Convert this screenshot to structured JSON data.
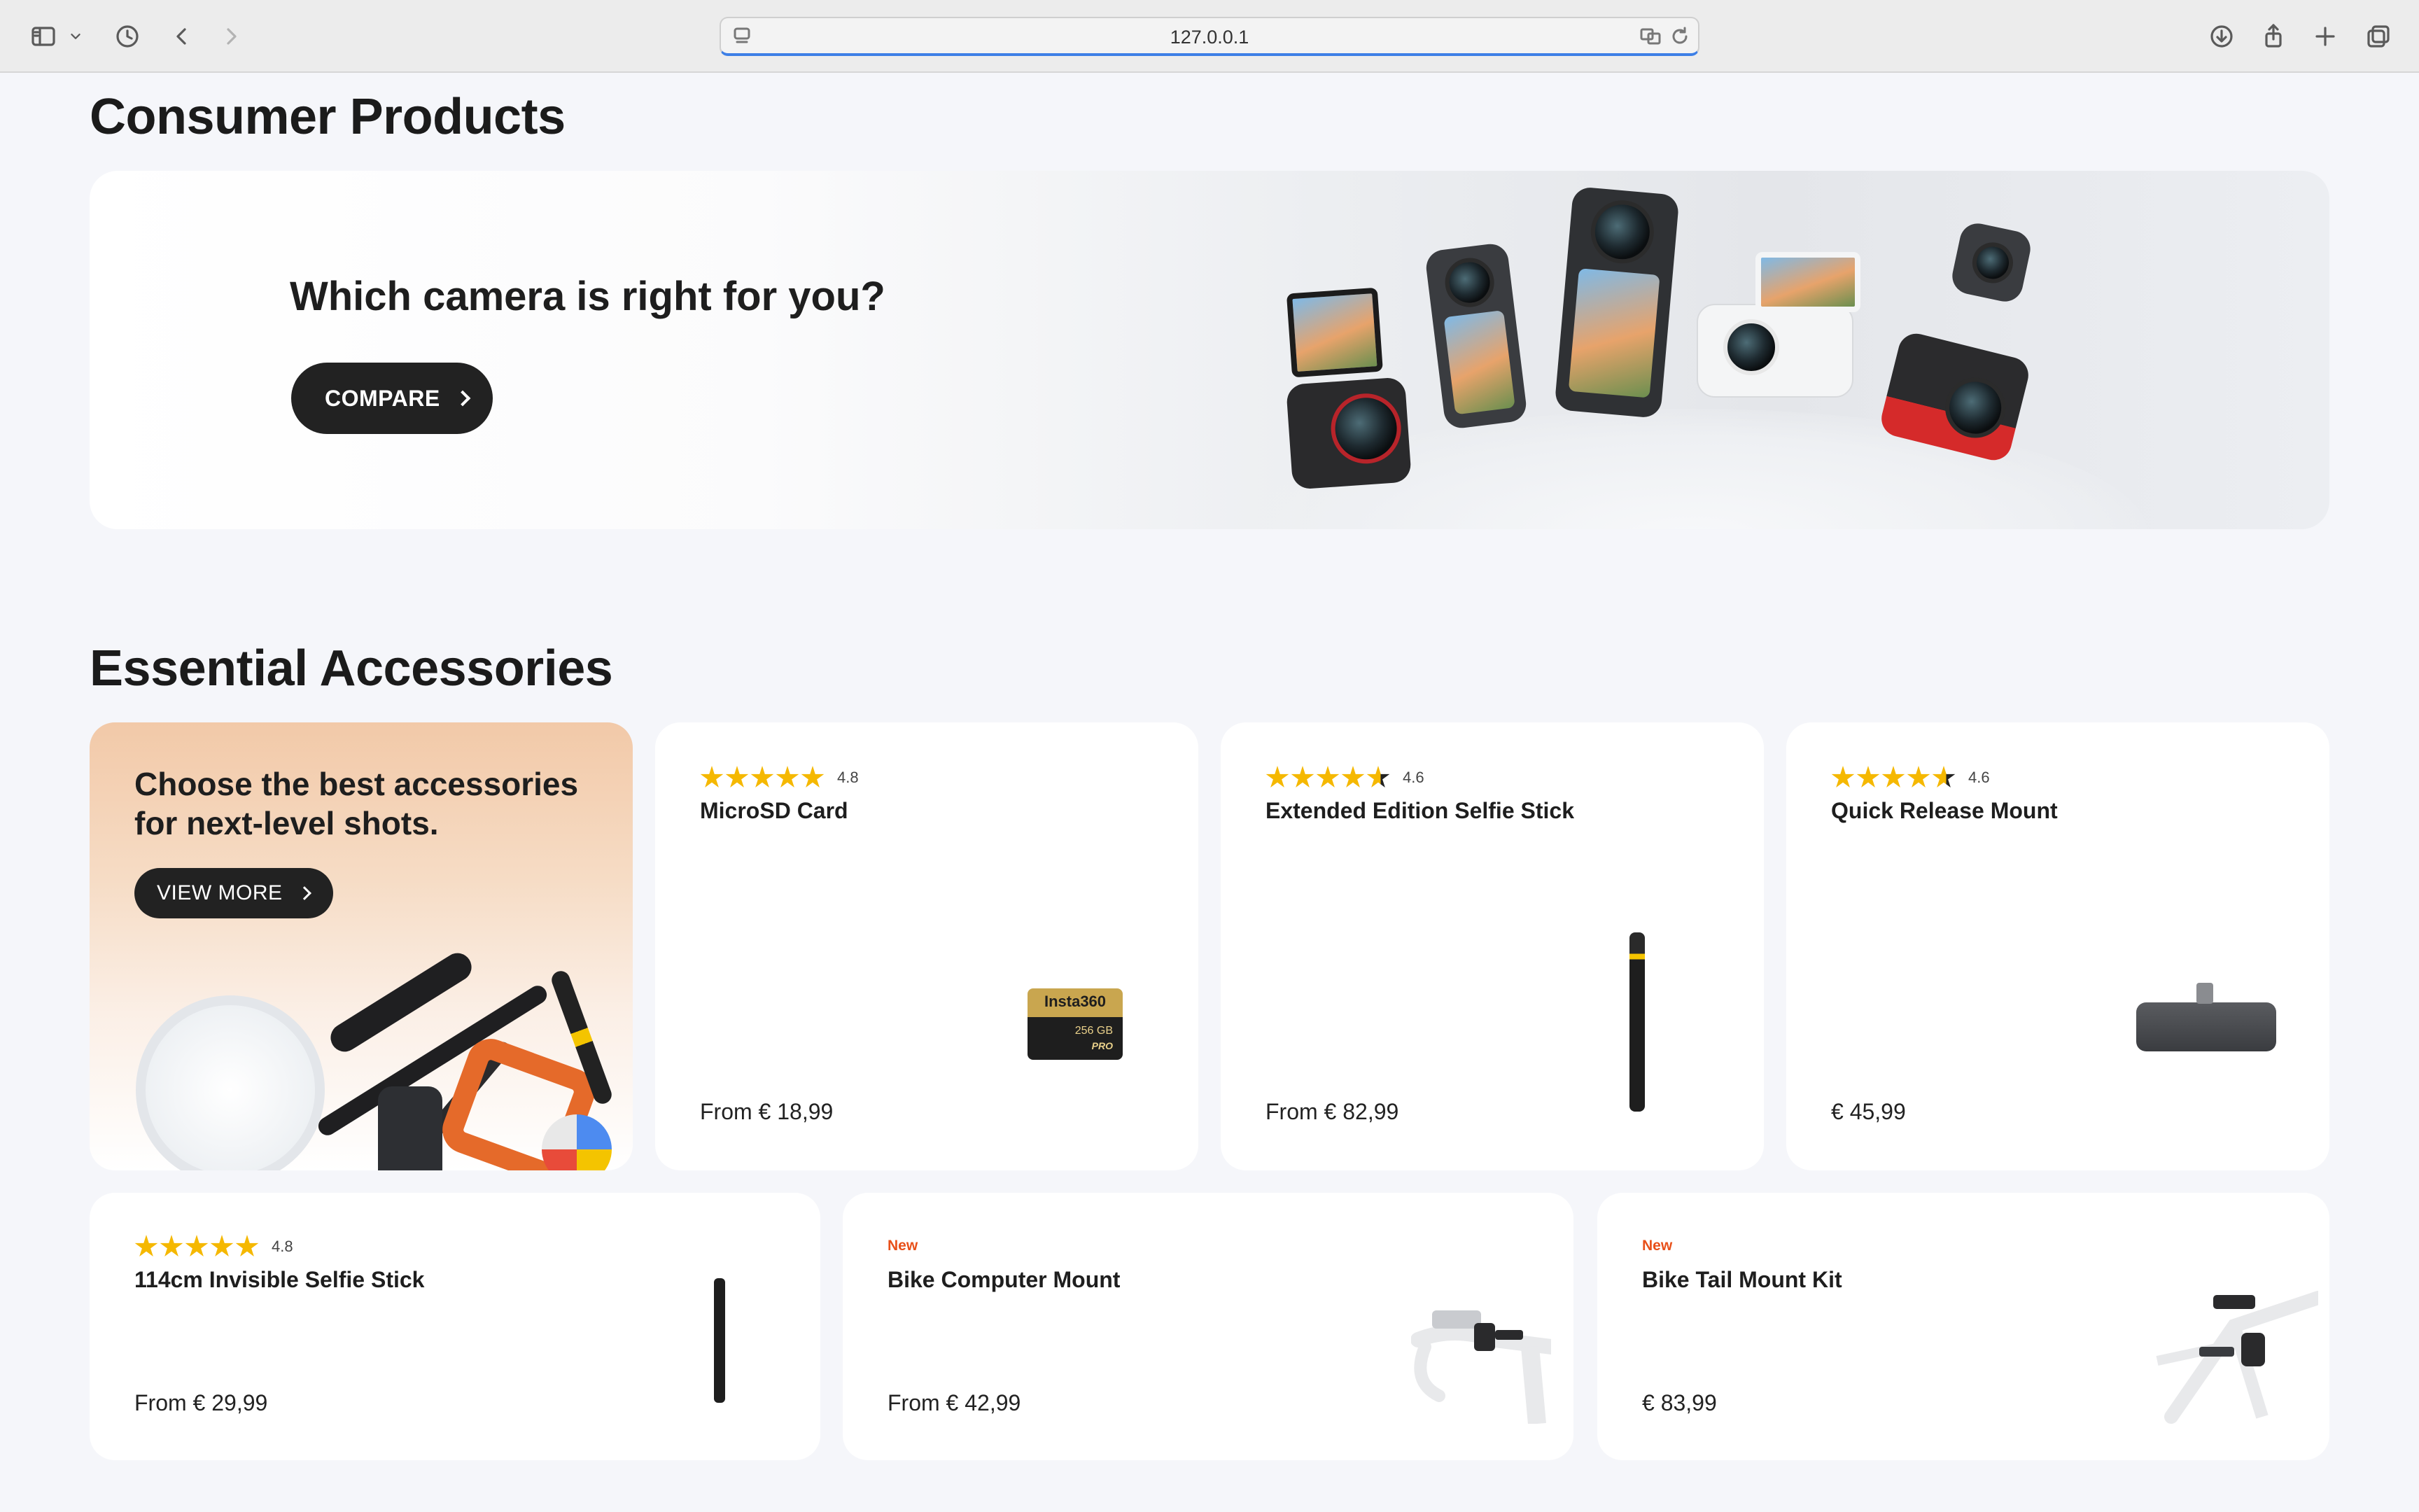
{
  "browser": {
    "url": "127.0.0.1"
  },
  "consumer": {
    "title": "Consumer Products",
    "hero_title": "Which camera is right for you?",
    "compare_label": "COMPARE"
  },
  "accessories": {
    "title": "Essential Accessories",
    "promo": {
      "text": "Choose the best accessories for next-level shots.",
      "button": "VIEW MORE"
    },
    "row1": [
      {
        "name": "MicroSD Card",
        "rating": "4.8",
        "stars": 5,
        "price": "From € 18,99",
        "card_brand": "Insta360",
        "card_capacity": "256 GB",
        "card_tag": "PRO"
      },
      {
        "name": "Extended Edition Selfie Stick",
        "rating": "4.6",
        "stars": 4.6,
        "price": "From € 82,99"
      },
      {
        "name": "Quick Release Mount",
        "rating": "4.6",
        "stars": 4.6,
        "price": "€ 45,99"
      }
    ],
    "row2": [
      {
        "name": "114cm Invisible Selfie Stick",
        "rating": "4.8",
        "price": "From € 29,99"
      },
      {
        "name": "Bike Computer Mount",
        "tag": "New",
        "price": "From € 42,99"
      },
      {
        "name": "Bike Tail Mount Kit",
        "tag": "New",
        "price": "€ 83,99"
      }
    ]
  },
  "colors": {
    "star": "#f5b800",
    "new_tag": "#e8501a",
    "pill": "#222222"
  }
}
